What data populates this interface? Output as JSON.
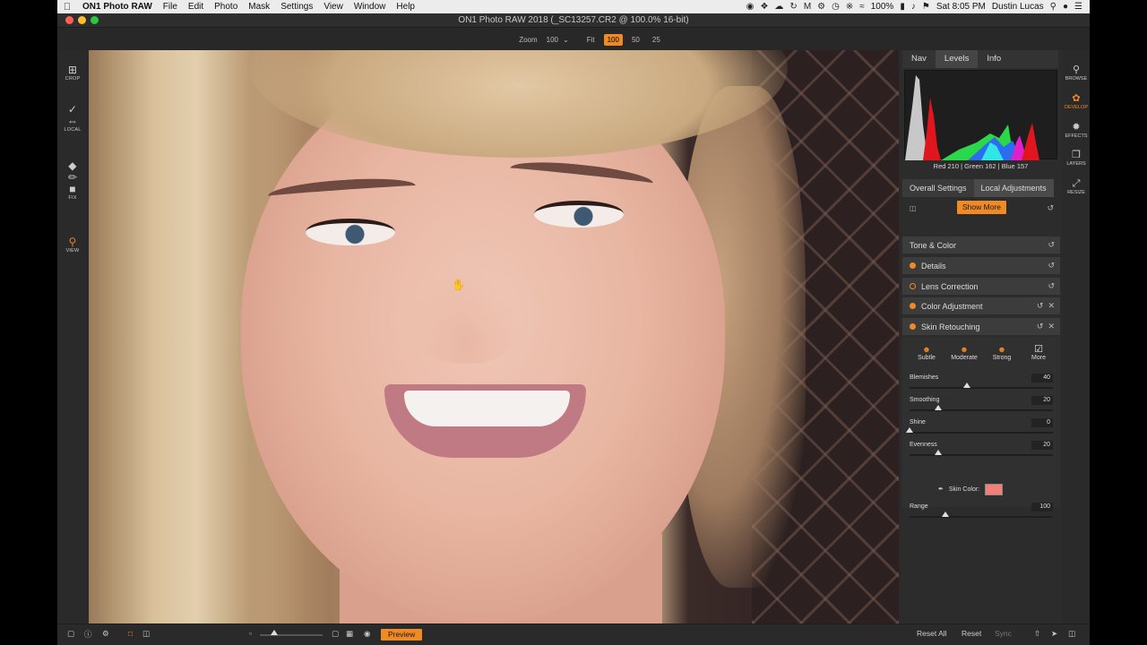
{
  "menubar": {
    "app_name": "ON1 Photo RAW",
    "menus": [
      "File",
      "Edit",
      "Photo",
      "Mask",
      "Settings",
      "View",
      "Window",
      "Help"
    ],
    "battery": "100%",
    "datetime": "Sat 8:05 PM",
    "user": "Dustin Lucas"
  },
  "window": {
    "title": "ON1 Photo RAW 2018 (_SC13257.CR2 @ 100.0% 16-bit)"
  },
  "zoombar": {
    "label": "Zoom",
    "value": "100",
    "buttons": [
      "Fit",
      "100",
      "50",
      "25"
    ],
    "active": "100"
  },
  "left_tools": [
    {
      "icon": "crop-icon",
      "label": "CROP"
    },
    {
      "icon": "local-adjust-icon",
      "label": "LOCAL"
    },
    {
      "icon": "fix-icon",
      "label": "FIX"
    },
    {
      "icon": "view-icon",
      "label": "VIEW"
    }
  ],
  "right_panel": {
    "tabs": [
      "Nav",
      "Levels",
      "Info"
    ],
    "active_tab": "Levels",
    "rgb_readout": {
      "red": "Red  210",
      "green": "Green  162",
      "blue": "Blue  157"
    },
    "settings_tabs": [
      "Overall Settings",
      "Local Adjustments"
    ],
    "show_more": "Show More",
    "sections": [
      {
        "label": "Tone & Color",
        "dot": "none"
      },
      {
        "label": "Details",
        "dot": "filled"
      },
      {
        "label": "Lens Correction",
        "dot": "hollow"
      },
      {
        "label": "Color Adjustment",
        "dot": "filled"
      },
      {
        "label": "Skin Retouching",
        "dot": "filled"
      }
    ],
    "skin": {
      "presets": [
        "Subtle",
        "Moderate",
        "Strong",
        "More"
      ],
      "sliders": [
        {
          "label": "Blemishes",
          "value": "40",
          "fraction": 0.4
        },
        {
          "label": "Smoothing",
          "value": "20",
          "fraction": 0.2
        },
        {
          "label": "Shine",
          "value": "0",
          "fraction": 0.0
        },
        {
          "label": "Evenness",
          "value": "20",
          "fraction": 0.2
        }
      ],
      "skin_color_label": "Skin Color:",
      "skin_color": "#f08078",
      "range": {
        "label": "Range",
        "value": "100",
        "fraction": 0.25
      }
    }
  },
  "modules": [
    {
      "icon": "browse-icon",
      "label": "BROWSE"
    },
    {
      "icon": "develop-icon",
      "label": "DEVELOP"
    },
    {
      "icon": "effects-icon",
      "label": "EFFECTS"
    },
    {
      "icon": "layers-icon",
      "label": "LAYERS"
    },
    {
      "icon": "resize-icon",
      "label": "RESIZE"
    }
  ],
  "bottombar": {
    "preview": "Preview",
    "reset_all": "Reset All",
    "reset": "Reset",
    "sync": "Sync"
  },
  "colors": {
    "accent": "#f08a24",
    "panel": "#2c2c2c"
  }
}
